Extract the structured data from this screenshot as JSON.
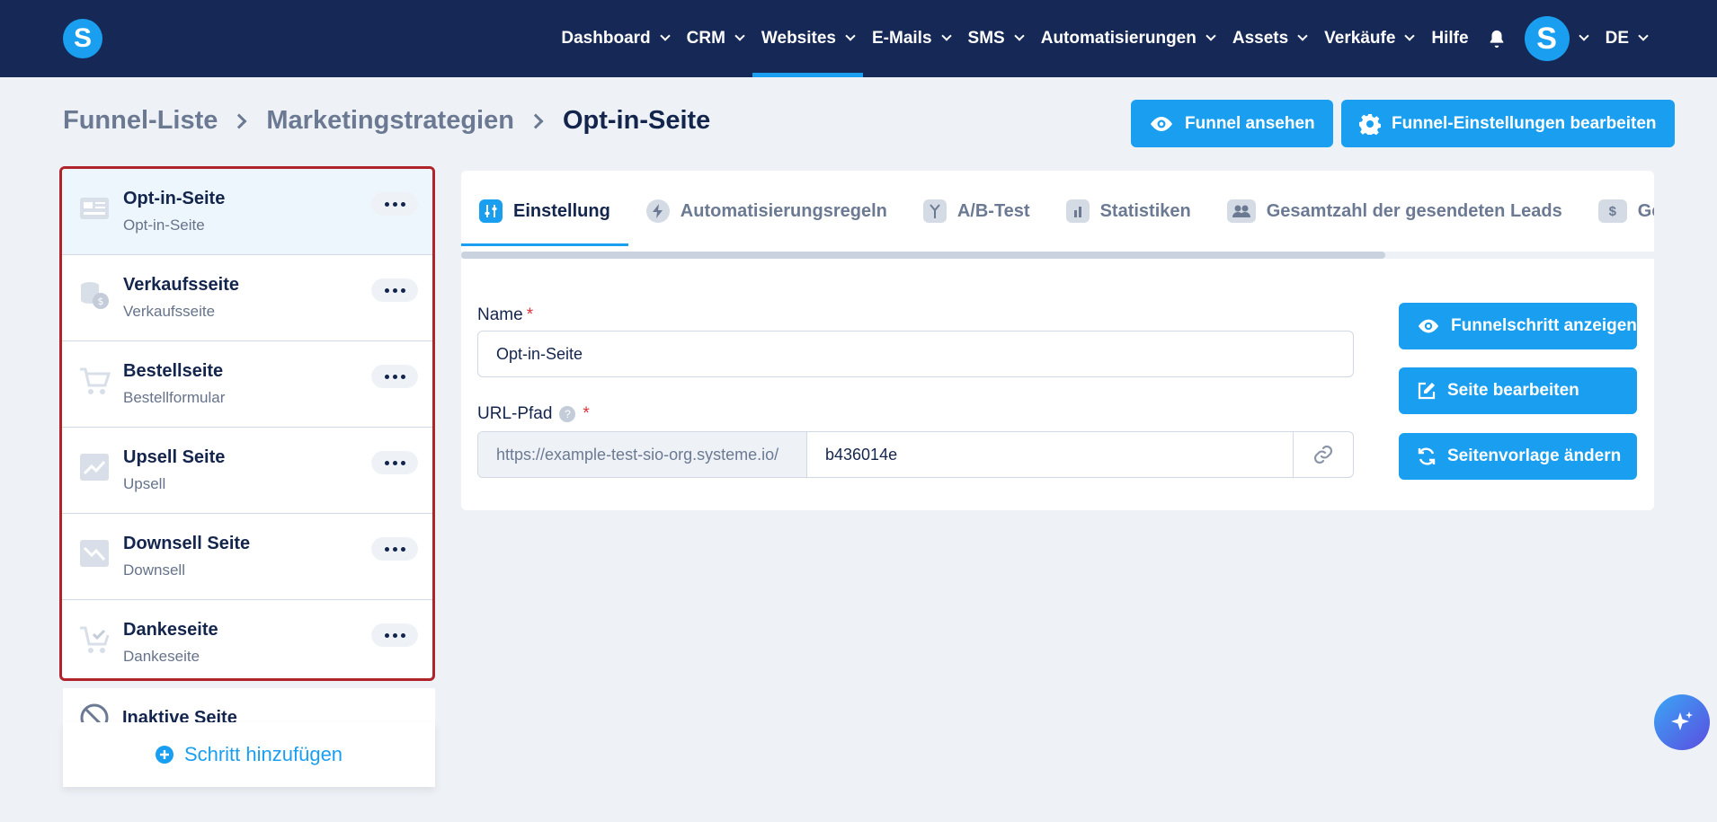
{
  "brand": {
    "logo_letter": "S",
    "accent": "#1a9ff0",
    "nav_bg": "#152856",
    "highlight_border": "#b0232a"
  },
  "nav": {
    "items": [
      {
        "label": "Dashboard",
        "dropdown": true,
        "active": false
      },
      {
        "label": "CRM",
        "dropdown": true,
        "active": false
      },
      {
        "label": "Websites",
        "dropdown": true,
        "active": true
      },
      {
        "label": "E-Mails",
        "dropdown": true,
        "active": false
      },
      {
        "label": "SMS",
        "dropdown": true,
        "active": false
      },
      {
        "label": "Automatisierungen",
        "dropdown": true,
        "active": false
      },
      {
        "label": "Assets",
        "dropdown": true,
        "active": false
      },
      {
        "label": "Verkäufe",
        "dropdown": true,
        "active": false
      },
      {
        "label": "Hilfe",
        "dropdown": false,
        "active": false
      }
    ],
    "avatar_letter": "S",
    "language": "DE"
  },
  "breadcrumb": {
    "items": [
      "Funnel-Liste",
      "Marketingstrategien"
    ],
    "current": "Opt-in-Seite"
  },
  "header_buttons": {
    "view_funnel": "Funnel ansehen",
    "edit_funnel_settings": "Funnel-Einstellungen bearbeiten"
  },
  "steps": [
    {
      "title": "Opt-in-Seite",
      "subtitle": "Opt-in-Seite",
      "icon": "optin-page-icon",
      "selected": true
    },
    {
      "title": "Verkaufsseite",
      "subtitle": "Verkaufsseite",
      "icon": "coins-icon",
      "selected": false
    },
    {
      "title": "Bestellseite",
      "subtitle": "Bestellformular",
      "icon": "cart-icon",
      "selected": false
    },
    {
      "title": "Upsell Seite",
      "subtitle": "Upsell",
      "icon": "trend-up-icon",
      "selected": false
    },
    {
      "title": "Downsell Seite",
      "subtitle": "Downsell",
      "icon": "trend-down-icon",
      "selected": false
    },
    {
      "title": "Dankeseite",
      "subtitle": "Dankeseite",
      "icon": "cart-check-icon",
      "selected": false
    }
  ],
  "inactive_section": {
    "label": "Inaktive Seite"
  },
  "add_step": {
    "label": "Schritt hinzufügen"
  },
  "tabs": [
    {
      "label": "Einstellung",
      "icon": "sliders-icon",
      "active": true
    },
    {
      "label": "Automatisierungsregeln",
      "icon": "bolt-icon",
      "active": false
    },
    {
      "label": "A/B-Test",
      "icon": "split-icon",
      "active": false
    },
    {
      "label": "Statistiken",
      "icon": "bar-chart-icon",
      "active": false
    },
    {
      "label": "Gesamtzahl der gesendeten Leads",
      "icon": "users-icon",
      "active": false
    },
    {
      "label": "Gesa",
      "icon": "dollar-icon",
      "active": false
    }
  ],
  "form": {
    "name_label": "Name",
    "name_value": "Opt-in-Seite",
    "url_label": "URL-Pfad",
    "help_glyph": "?",
    "required_mark": "*",
    "url_prefix": "https://example-test-sio-org.systeme.io/",
    "url_slug": "b436014e"
  },
  "side_buttons": {
    "show_step": "Funnelschritt anzeigen",
    "edit_page": "Seite bearbeiten",
    "change_template": "Seitenvorlage ändern"
  }
}
